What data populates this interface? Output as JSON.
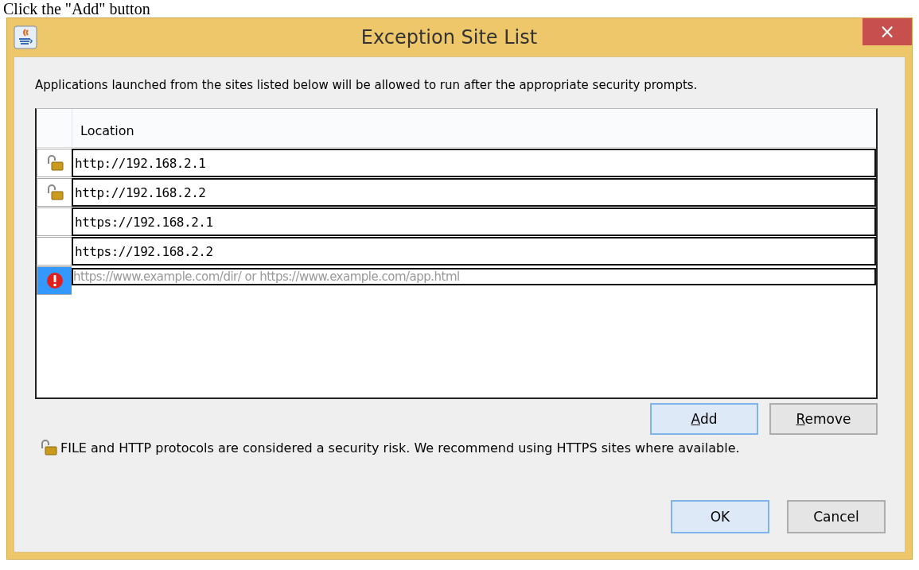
{
  "caption": "Click the \"Add\" button",
  "window": {
    "title": "Exception Site List",
    "close": "×"
  },
  "intro": "Applications launched from the sites listed below will be allowed to run after the appropriate security prompts.",
  "table": {
    "columns": [
      "Location"
    ],
    "rows": [
      {
        "kind": "insecure",
        "location": "http://192.168.2.1",
        "selected": false
      },
      {
        "kind": "insecure",
        "location": "http://192.168.2.2",
        "selected": false
      },
      {
        "kind": "secure",
        "location": "https://192.168.2.1",
        "selected": false
      },
      {
        "kind": "secure",
        "location": "https://192.168.2.2",
        "selected": false
      },
      {
        "kind": "invalid",
        "placeholder": "https://www.example.com/dir/ or https://www.example.com/app.html",
        "selected": true
      }
    ]
  },
  "table_buttons": [
    {
      "label": "Add",
      "mnemonic": true,
      "focused": true
    },
    {
      "label": "Remove",
      "mnemonic": true,
      "focused": false
    }
  ],
  "notice": {
    "text": "FILE and HTTP protocols are considered a security risk.  We recommend using HTTPS sites where available."
  },
  "buttons": [
    {
      "label": "OK",
      "mnemonic": false,
      "focused": true
    },
    {
      "label": "Cancel",
      "mnemonic": false,
      "focused": false
    }
  ]
}
